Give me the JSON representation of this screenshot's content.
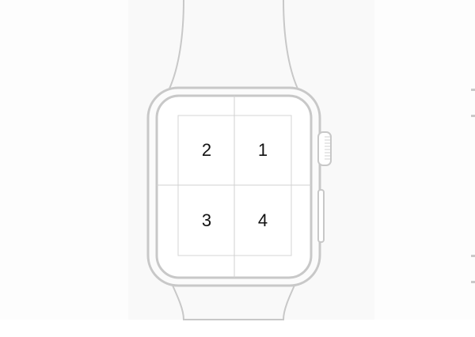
{
  "quadrants": {
    "top_left": "2",
    "top_right": "1",
    "bottom_left": "3",
    "bottom_right": "4"
  },
  "colors": {
    "outline": "#c8c8c8",
    "grid": "#cfcfcf",
    "label": "#111111",
    "background": "#f9f9f9"
  }
}
